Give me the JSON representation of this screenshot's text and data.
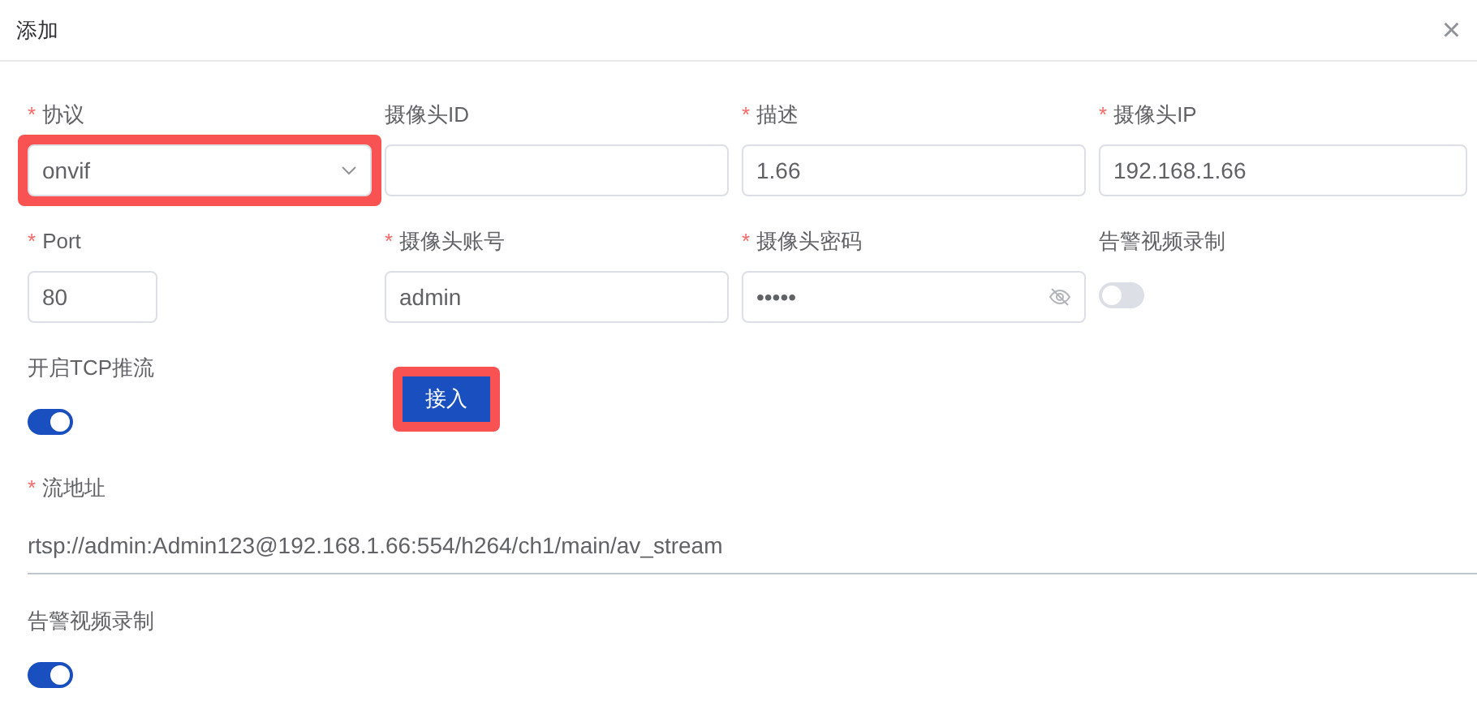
{
  "dialog": {
    "title": "添加",
    "close_icon": "×"
  },
  "fields": [
    {
      "kind": "select",
      "mark": "*",
      "label": "协议",
      "value": "onvif",
      "highlighted": true
    },
    {
      "kind": "text",
      "label": "摄像头ID"
    },
    {
      "kind": "text",
      "mark": "*",
      "label": "描述",
      "value": "1.66"
    },
    {
      "kind": "text",
      "mark": "*",
      "label": "摄像头IP",
      "value": "192.168.1.66"
    },
    {
      "kind": "short",
      "mark": "*",
      "label": "Port",
      "value": "80"
    },
    {
      "kind": "text",
      "mark": "*",
      "label": "摄像头账号",
      "value": "admin"
    },
    {
      "kind": "password",
      "mark": "*",
      "label": "摄像头密码",
      "value": "•••••"
    },
    {
      "kind": "switch",
      "label": "告警视频录制",
      "on": false
    },
    {
      "kind": "switch",
      "label": "开启TCP推流",
      "on": true
    },
    {
      "kind": "button",
      "label": "接入",
      "highlighted": true
    }
  ],
  "stream": {
    "mark": "*",
    "label": "流地址",
    "value": "rtsp://admin:Admin123@192.168.1.66:554/h264/ch1/main/av_stream"
  },
  "alarm": {
    "label": "告警视频录制",
    "on": true
  }
}
